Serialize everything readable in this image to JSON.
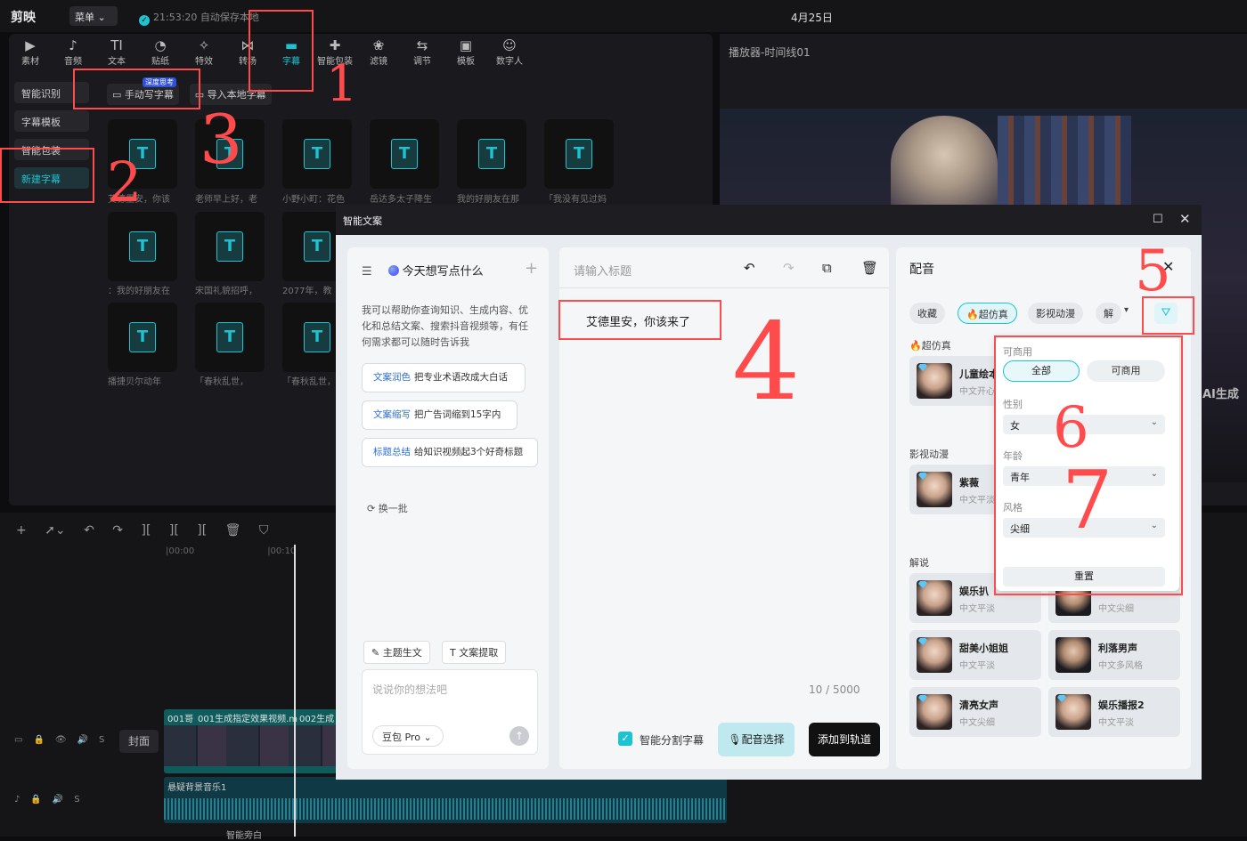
{
  "app": {
    "logo": "剪映",
    "menu_label": "菜单",
    "autosave": "21:53:20 自动保存本地",
    "project_title": "4月25日"
  },
  "toolbar": {
    "items": [
      {
        "label": "素材",
        "icon": "▶"
      },
      {
        "label": "音频",
        "icon": "♪"
      },
      {
        "label": "文本",
        "icon": "TI"
      },
      {
        "label": "贴纸",
        "icon": "◔"
      },
      {
        "label": "特效",
        "icon": "✧"
      },
      {
        "label": "转场",
        "icon": "⋈"
      },
      {
        "label": "字幕",
        "icon": "▬"
      },
      {
        "label": "智能包装",
        "icon": "✚"
      },
      {
        "label": "滤镜",
        "icon": "❀"
      },
      {
        "label": "调节",
        "icon": "⇆"
      },
      {
        "label": "模板",
        "icon": "▣"
      },
      {
        "label": "数字人",
        "icon": "☺"
      }
    ]
  },
  "sidebar": {
    "items": [
      {
        "label": "智能识别"
      },
      {
        "label": "字幕模板"
      },
      {
        "label": "智能包装"
      },
      {
        "label": "新建字幕"
      }
    ]
  },
  "subtabs": {
    "manual": "手动写字幕",
    "manual_badge": "深度思考",
    "import": "导入本地字幕"
  },
  "thumbs": {
    "row1": [
      "艾德里安，你该",
      "老师早上好，老",
      "小野小町：花色",
      "岳达多太子降生",
      "我的好朋友在那",
      "「我没有见过妈"
    ],
    "row2": [
      "：我的好朋友在",
      "宋国礼貌招呼，",
      "2077年，教"
    ],
    "row3": [
      "播捷贝尔动年",
      "「春秋乱世，",
      "「春秋乱世，"
    ]
  },
  "player": {
    "title": "播放器-时间线01",
    "ai_label": "AI生成"
  },
  "timeline": {
    "ruler": [
      "|00:00",
      "|00:10"
    ],
    "cover": "封面",
    "clips": [
      "001哥",
      "001生成指定效果视频.m",
      "002生成"
    ],
    "audio_label": "悬疑背景音乐1",
    "tts_label": "智能旁白"
  },
  "dialog": {
    "title": "智能文案",
    "ai": {
      "heading": "今天想写点什么",
      "intro": "我可以帮助你查询知识、生成内容、优化和总结文案、搜索抖音视频等，有任何需求都可以随时告诉我",
      "suggestions": [
        {
          "key": "文案润色",
          "text": "把专业术语改成大白话"
        },
        {
          "key": "文案缩写",
          "text": "把广告词缩到15字内"
        },
        {
          "key": "标题总结",
          "text": "给知识视频起3个好奇标题"
        }
      ],
      "refresh": "换一批",
      "chip_topic": "主题生文",
      "chip_extract": "文案提取",
      "input_placeholder": "说说你的想法吧",
      "model": "豆包 Pro"
    },
    "editor": {
      "title_placeholder": "请输入标题",
      "text": "艾德里安，你该来了",
      "counter": "10 / 5000",
      "split_label": "智能分割字幕",
      "voice_btn": "配音选择",
      "add_btn": "添加到轨道"
    },
    "voice": {
      "title": "配音",
      "tabs": [
        "收藏",
        "🔥超仿真",
        "影视动漫",
        "解"
      ],
      "sections": {
        "hyper": "🔥超仿真",
        "film": "影视动漫",
        "narration": "解说"
      },
      "cards": [
        {
          "name": "儿童绘本",
          "desc": "中文开心",
          "gender": "f"
        },
        {
          "name": "紫薇",
          "desc": "中文平淡",
          "gender": "f"
        },
        {
          "name": "娱乐扒",
          "desc": "中文平淡",
          "gender": "f"
        },
        {
          "name": "",
          "desc": "中文尖细",
          "gender": "m"
        },
        {
          "name": "甜美小姐姐",
          "desc": "中文平淡",
          "gender": "f"
        },
        {
          "name": "利落男声",
          "desc": "中文多风格",
          "gender": "m"
        },
        {
          "name": "清亮女声",
          "desc": "中文尖细",
          "gender": "f"
        },
        {
          "name": "娱乐播报2",
          "desc": "中文平淡",
          "gender": "f"
        }
      ],
      "filter": {
        "commercial_label": "可商用",
        "opt_all": "全部",
        "opt_commercial": "可商用",
        "gender_label": "性别",
        "gender_value": "女",
        "age_label": "年龄",
        "age_value": "青年",
        "style_label": "风格",
        "style_value": "尖细",
        "reset": "重置"
      }
    }
  },
  "annotations": [
    "1",
    "2",
    "3",
    "4",
    "5",
    "6",
    "7"
  ]
}
